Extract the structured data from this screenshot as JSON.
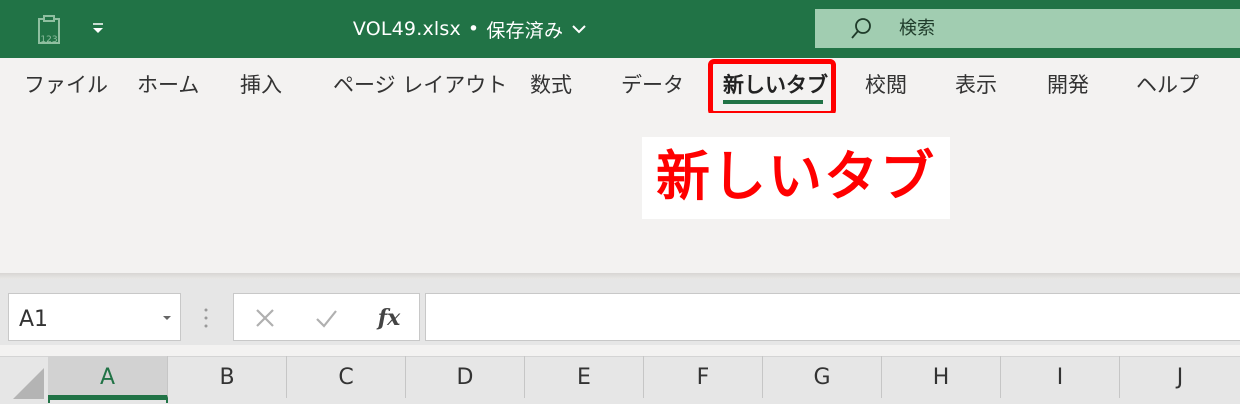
{
  "titlebar": {
    "filename": "VOL49.xlsx",
    "separator": "•",
    "save_status": "保存済み",
    "search_placeholder": "検索",
    "bg_color": "#217346"
  },
  "ribbon": {
    "tabs": [
      {
        "label": "ファイル"
      },
      {
        "label": "ホーム"
      },
      {
        "label": "挿入"
      },
      {
        "label": "ページ レイアウト"
      },
      {
        "label": "数式"
      },
      {
        "label": "データ"
      },
      {
        "label": "新しいタブ",
        "active": true
      },
      {
        "label": "校閲"
      },
      {
        "label": "表示"
      },
      {
        "label": "開発"
      },
      {
        "label": "ヘルプ"
      }
    ],
    "highlight_color": "#ff0000"
  },
  "callout": {
    "text": "新しいタブ",
    "color": "#ff0000"
  },
  "formula_bar": {
    "name_box_value": "A1",
    "fx_label": "fx",
    "formula_value": ""
  },
  "columns": [
    "A",
    "B",
    "C",
    "D",
    "E",
    "F",
    "G",
    "H",
    "I",
    "J"
  ],
  "selected_column": "A",
  "icons": {
    "quick_access": "autosum-123-icon",
    "customize": "dropdown-arrow-icon",
    "search": "search-icon",
    "cancel": "cancel-icon",
    "enter": "checkmark-icon"
  }
}
